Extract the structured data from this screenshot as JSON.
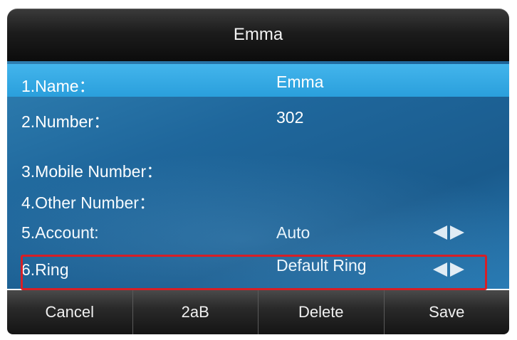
{
  "header": {
    "title": "Emma"
  },
  "fields": [
    {
      "label": "1.Name：",
      "value": "Emma",
      "selected": true,
      "has_arrows": false
    },
    {
      "label": "2.Number：",
      "value": "302",
      "selected": false,
      "has_arrows": false
    },
    {
      "label": "3.Mobile Number：",
      "value": "",
      "selected": false,
      "has_arrows": false
    },
    {
      "label": "4.Other Number：",
      "value": "",
      "selected": false,
      "has_arrows": false
    },
    {
      "label": "5.Account:",
      "value": "Auto",
      "selected": false,
      "has_arrows": true
    },
    {
      "label": "6.Ring",
      "value": "Default Ring",
      "selected": false,
      "has_arrows": true
    }
  ],
  "softkeys": {
    "cancel": "Cancel",
    "input_mode": "2aB",
    "delete": "Delete",
    "save": "Save"
  },
  "colors": {
    "selected_row": "#2a9fdc",
    "list_background": "#1f679c",
    "highlight_box": "#d61f26"
  }
}
